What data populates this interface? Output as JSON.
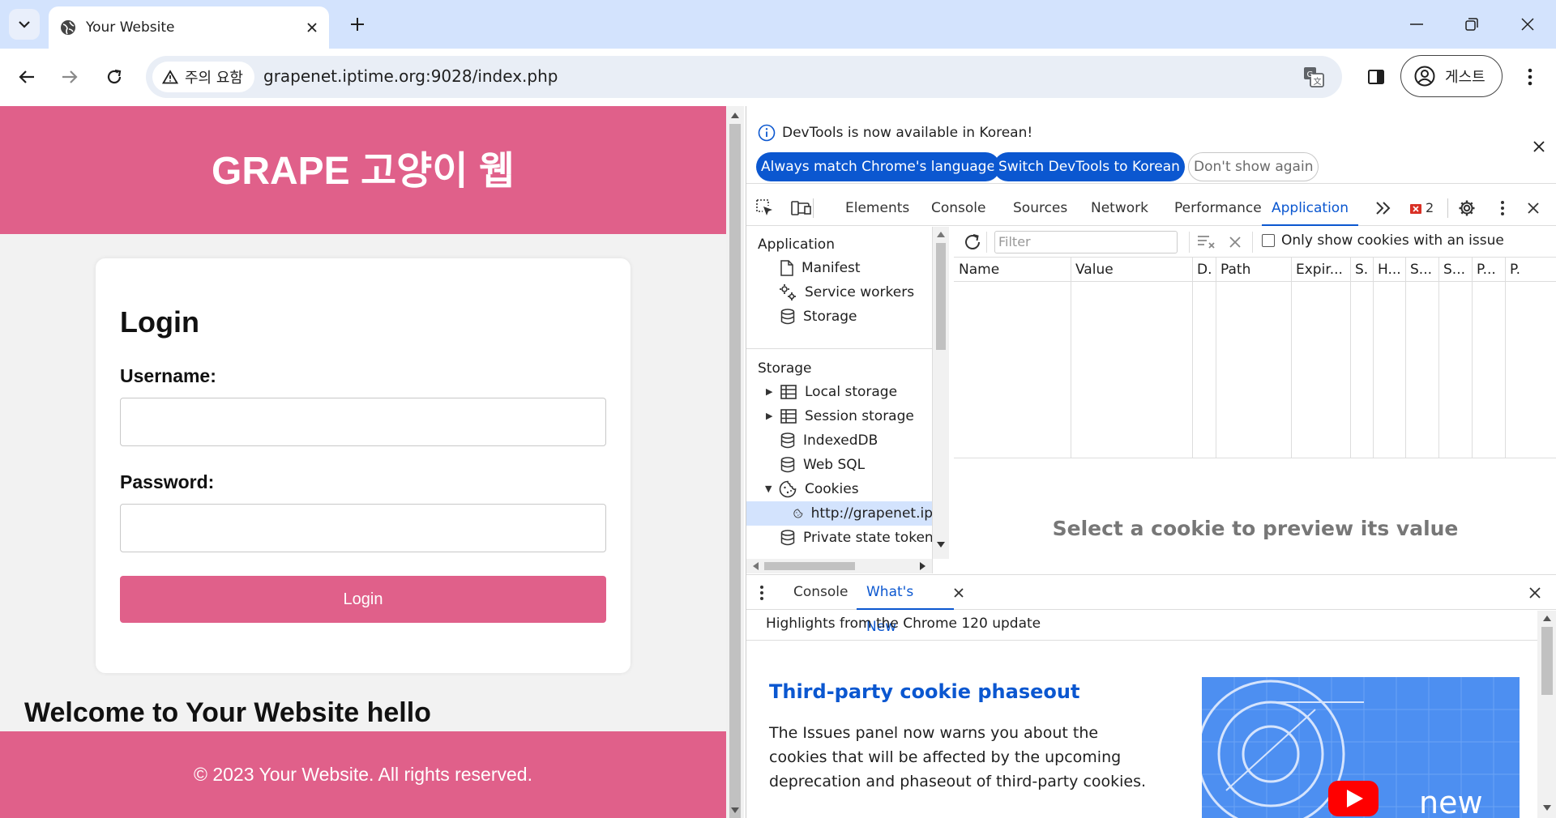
{
  "browser": {
    "tab_title": "Your Website",
    "security_label": "주의 요함",
    "url": "grapenet.iptime.org:9028/index.php",
    "profile_label": "게스트"
  },
  "page": {
    "site_title": "GRAPE 고양이 웹",
    "login_heading": "Login",
    "username_label": "Username:",
    "username_value": "",
    "password_label": "Password:",
    "password_value": "",
    "login_button": "Login",
    "welcome_text": "Welcome to Your Website hello",
    "footer_text": "© 2023 Your Website. All rights reserved.",
    "brand_color": "#e0608a"
  },
  "devtools": {
    "infobar": {
      "message": "DevTools is now available in Korean!",
      "always_match": "Always match Chrome's language",
      "switch_korean": "Switch DevTools to Korean",
      "dont_show": "Don't show again"
    },
    "tabs": [
      "Elements",
      "Console",
      "Sources",
      "Network",
      "Performance",
      "Application"
    ],
    "active_tab": "Application",
    "issues_count": "2",
    "sidebar": {
      "application_heading": "Application",
      "application_items": [
        "Manifest",
        "Service workers",
        "Storage"
      ],
      "storage_heading": "Storage",
      "storage_items": [
        "Local storage",
        "Session storage",
        "IndexedDB",
        "Web SQL",
        "Cookies"
      ],
      "cookie_origin": "http://grapenet.ip",
      "private_state": "Private state tokens"
    },
    "cookies": {
      "filter_placeholder": "Filter",
      "only_issue_label": "Only show cookies with an issue",
      "columns": [
        "Name",
        "Value",
        "D.",
        "Path",
        "Expir...",
        "S.",
        "H...",
        "S...",
        "S...",
        "P...",
        "P."
      ],
      "preview_text": "Select a cookie to preview its value"
    },
    "drawer": {
      "tabs": [
        "Console",
        "What's New"
      ],
      "active_tab": "What's New",
      "highlights": "Highlights from the Chrome 120 update",
      "article_title": "Third-party cookie phaseout",
      "article_body": "The Issues panel now warns you about the cookies that will be affected by the upcoming deprecation and phaseout of third-party cookies.",
      "image_caption": "new"
    }
  }
}
